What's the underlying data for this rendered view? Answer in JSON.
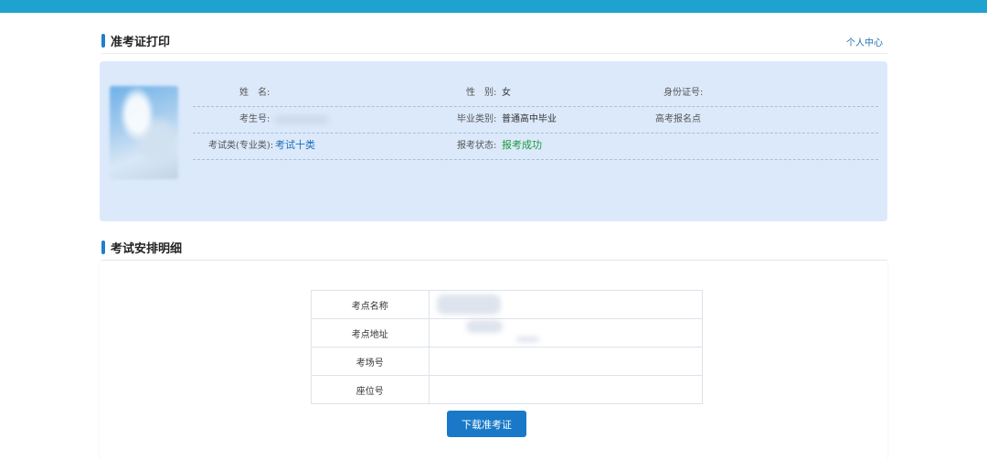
{
  "header": {
    "title": "准考证打印",
    "personal_center": "个人中心"
  },
  "candidate": {
    "name_label": "姓　名:",
    "gender_label": "性　别:",
    "gender_value": "女",
    "id_label": "身份证号:",
    "exam_no_label": "考生号:",
    "grad_label": "毕业类别:",
    "grad_value": "普通高中毕业",
    "reg_site_label": "高考报名点",
    "category_label": "考试类(专业类):",
    "category_value": "考试十类",
    "status_label": "报考状态:",
    "status_value": "报考成功"
  },
  "exam": {
    "title": "考试安排明细",
    "rows": [
      {
        "label": "考点名称",
        "value": ""
      },
      {
        "label": "考点地址",
        "value": ""
      },
      {
        "label": "考场号",
        "value": ""
      },
      {
        "label": "座位号",
        "value": ""
      }
    ],
    "download_label": "下载准考证"
  },
  "colors": {
    "topbar": "#1ea2cf",
    "panel": "#dbe9fb",
    "accent": "#1e7fd0",
    "button": "#1979c8",
    "success": "#1f9a3c"
  }
}
